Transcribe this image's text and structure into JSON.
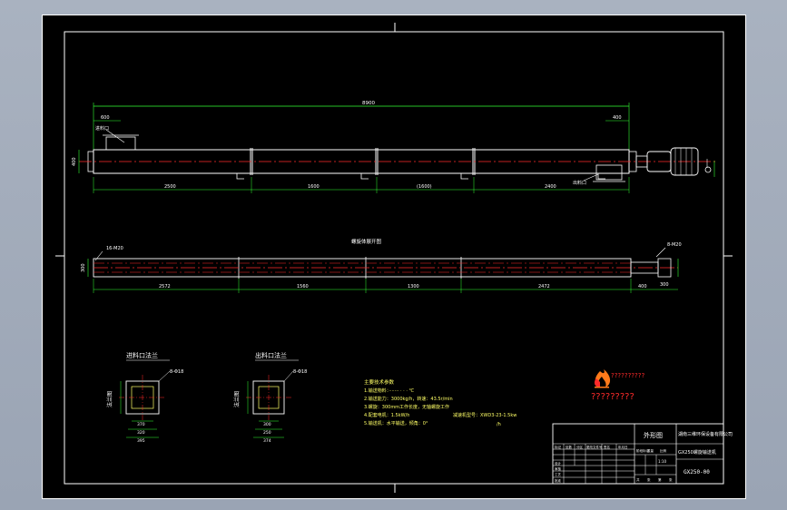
{
  "dims_top": {
    "overall": "8900",
    "inlet_offset": "600",
    "outlet_offset": "400",
    "sections": [
      "2500",
      "1600",
      "(1600)",
      "2400"
    ],
    "height": "400"
  },
  "labels_top": {
    "inlet": "进料口",
    "outlet": "出料口"
  },
  "mid_title": "螺旋体展开图",
  "dims_mid": {
    "left_note": "16-M20",
    "right_note": "8-M20",
    "height": "300",
    "sections": [
      "2572",
      "1560",
      "1300",
      "2472"
    ],
    "end_a": "400",
    "end_b": "300"
  },
  "flange_inlet": {
    "title": "进料口法兰",
    "side_label": "法兰图",
    "note": "8-Φ18",
    "dims": [
      "370",
      "320",
      "395"
    ]
  },
  "flange_outlet": {
    "title": "出料口法兰",
    "side_label": "法兰图",
    "note": "8-Φ18",
    "dims": [
      "300",
      "250",
      "374"
    ]
  },
  "tech": {
    "heading": "主要技术参数",
    "lines": [
      "1.输送物料：······· · · · ℃",
      "2.输送能力：3000kg/h，转速：43.5r/min",
      "3.螺旋：300mm工作长度，无轴螺旋工作",
      "4.配套电机：1.5kW/h",
      "5.输送机：水平输送，倾角：0°"
    ],
    "reducer": "减速机型号：XWD3-23-1.5kw",
    "unit": "/h"
  },
  "logo": {
    "brand_text": "??????????",
    "brand_text2": "?????????"
  },
  "title_block": {
    "sheet": "外形图",
    "company": "湖南三维环保设备有限公司",
    "product": "GX250螺旋输送机",
    "drawing_no": "GX250-00",
    "scale": "1:10",
    "rev_headers": [
      "标记",
      "处数",
      "分区",
      "更改文件号",
      "签名",
      "年月日"
    ],
    "role_labels": [
      "设计",
      "审核",
      "工艺",
      "批准"
    ],
    "stage_labels": [
      "阶段标记",
      "重量",
      "比例"
    ],
    "sheet_labels": [
      "共",
      "张",
      "第",
      "张"
    ]
  },
  "colors": {
    "background": "#000000",
    "outline": "#ffffff",
    "dimension": "#33ff33",
    "centerline": "#ff2a2a",
    "note": "#ffff66",
    "desktop": "#a0aaba"
  }
}
